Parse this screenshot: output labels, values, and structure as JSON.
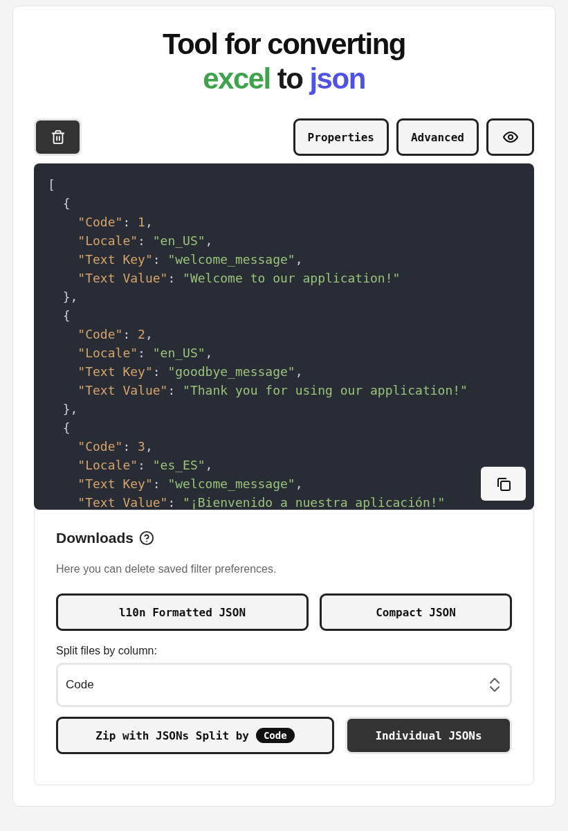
{
  "title": {
    "line1": "Tool for converting",
    "line2": [
      {
        "text": "excel",
        "color": "#3fa34d"
      },
      {
        "text": "to",
        "color": "#1a1a1a"
      },
      {
        "text": "json",
        "color": "#4f52e6"
      }
    ]
  },
  "toolbar": {
    "buttons": [
      {
        "label": "Properties"
      },
      {
        "label": "Advanced"
      }
    ]
  },
  "code": {
    "lines": [
      "[",
      "  {",
      "    \"Code\": 1,",
      "    \"Locale\": \"en_US\",",
      "    \"Text Key\": \"welcome_message\",",
      "    \"Text Value\": \"Welcome to our application!\"",
      "  },",
      "  {",
      "    \"Code\": 2,",
      "    \"Locale\": \"en_US\",",
      "    \"Text Key\": \"goodbye_message\",",
      "    \"Text Value\": \"Thank you for using our application!\"",
      "  },",
      "  {",
      "    \"Code\": 3,",
      "    \"Locale\": \"es_ES\",",
      "    \"Text Key\": \"welcome_message\",",
      "    \"Text Value\": \"¡Bienvenido a nuestra aplicación!\""
    ]
  },
  "downloads": {
    "title": "Downloads",
    "description": "Here you can delete saved filter preferences.",
    "format_buttons": [
      {
        "label": "l10n Formatted JSON"
      },
      {
        "label": "Compact JSON"
      }
    ],
    "split_label": "Split files by column:",
    "split_value": "Code",
    "split_buttons": [
      {
        "label": "Zip with JSONs Split by",
        "badge": "Code",
        "kind": "outline"
      },
      {
        "label": "Individual JSONs",
        "kind": "dark"
      }
    ]
  }
}
